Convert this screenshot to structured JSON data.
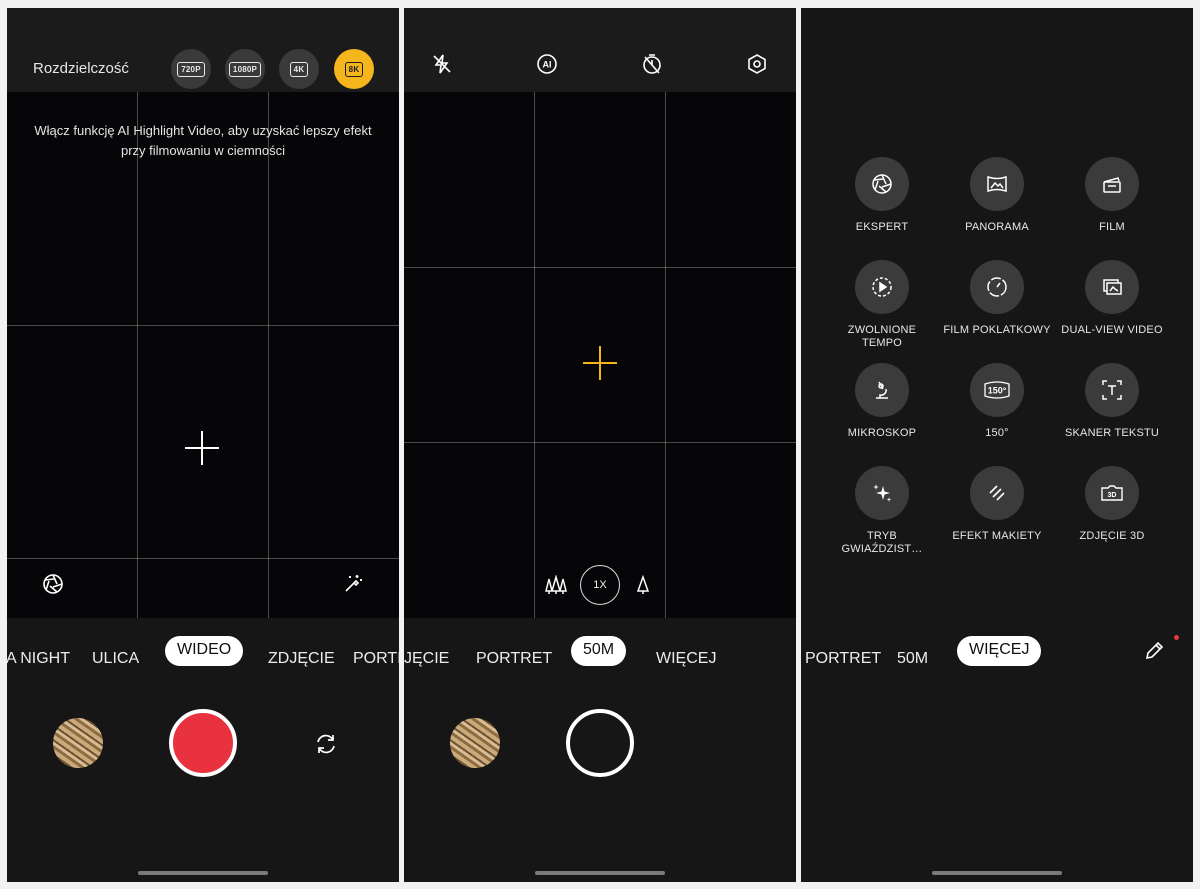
{
  "panel_video": {
    "resolution_label": "Rozdzielczość",
    "resolutions": [
      "720P",
      "1080P",
      "4K",
      "8K"
    ],
    "active_resolution": "8K",
    "hint": "Włącz funkcję AI Highlight Video, aby uzyskać lepszy efekt przy filmowaniu w ciemności",
    "modes": [
      "A NIGHT",
      "ULICA",
      "WIDEO",
      "ZDJĘCIE",
      "PORTI"
    ],
    "selected_mode": "WIDEO"
  },
  "panel_photo": {
    "zoom": "1X",
    "modes": [
      "JĘCIE",
      "PORTRET",
      "50M",
      "WIĘCEJ"
    ],
    "selected_mode": "50M"
  },
  "panel_more": {
    "modes": [
      "PORTRET",
      "50M",
      "WIĘCEJ"
    ],
    "selected_mode": "WIĘCEJ",
    "tiles": [
      {
        "label": "EKSPERT",
        "icon": "aperture-icon"
      },
      {
        "label": "PANORAMA",
        "icon": "panorama-icon"
      },
      {
        "label": "FILM",
        "icon": "film-icon"
      },
      {
        "label": "ZWOLNIONE TEMPO",
        "icon": "slow-motion-icon"
      },
      {
        "label": "FILM POKLATKOWY",
        "icon": "timelapse-icon"
      },
      {
        "label": "DUAL-VIEW VIDEO",
        "icon": "dual-view-icon"
      },
      {
        "label": "MIKROSKOP",
        "icon": "microscope-icon"
      },
      {
        "label": "150°",
        "icon": "wide-150-icon"
      },
      {
        "label": "SKANER TEKSTU",
        "icon": "text-scanner-icon"
      },
      {
        "label": "TRYB GWIAŹDZIST…",
        "icon": "stars-icon"
      },
      {
        "label": "EFEKT MAKIETY",
        "icon": "tilt-shift-icon"
      },
      {
        "label": "ZDJĘCIE 3D",
        "icon": "photo-3d-icon"
      }
    ]
  },
  "colors": {
    "accent": "#f5b51c",
    "record": "#e8323f",
    "background": "#161616"
  }
}
